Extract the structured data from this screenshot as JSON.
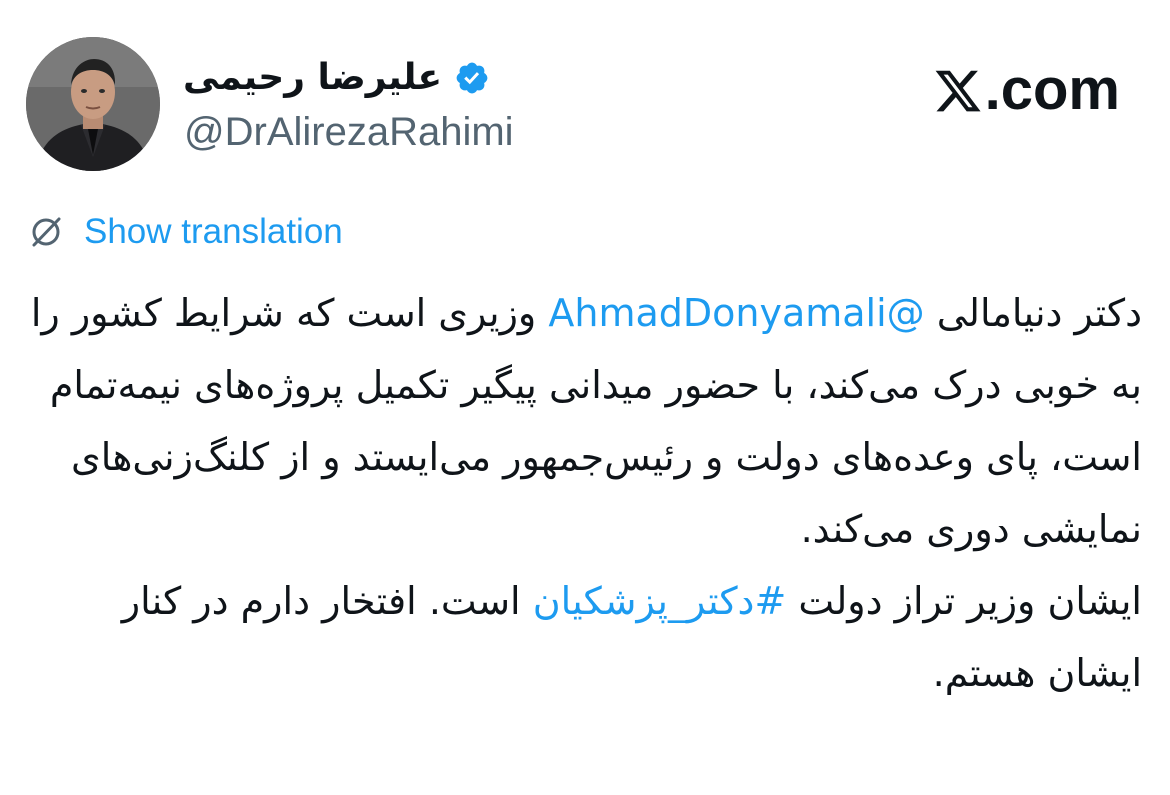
{
  "author": {
    "display_name": "علیرضا رحیمی",
    "handle": "@DrAlirezaRahimi",
    "verified_icon": "verified-badge-icon",
    "verified_color": "#1d9bf0",
    "avatar_icon": "profile-avatar"
  },
  "brand": {
    "logo_icon": "x-logo-icon",
    "domain_text": ".com"
  },
  "translation": {
    "icon": "globe-slash-icon",
    "label": "Show translation"
  },
  "tweet": {
    "p1_before_mention": "دکتر دنیامالی ",
    "mention": "@AhmadDonyamali",
    "p1_after_mention": " وزیری است که شرایط کشور را به خوبی درک می‌کند، با حضور میدانی پیگیر تکمیل پروژه‌های نیمه‌تمام است، پای وعده‌های دولت و رئیس‌جمهور می‌ایستد و از کلنگ‌زنی‌های نمایشی دوری می‌کند.",
    "p2_before_hashtag": "ایشان وزیر تراز دولت ",
    "hashtag": "#دکتر_پزشکیان",
    "p2_after_hashtag": " است. افتخار دارم در کنار ایشان هستم."
  },
  "colors": {
    "text": "#0f1419",
    "secondary": "#536471",
    "link": "#1d9bf0",
    "background": "#ffffff"
  }
}
